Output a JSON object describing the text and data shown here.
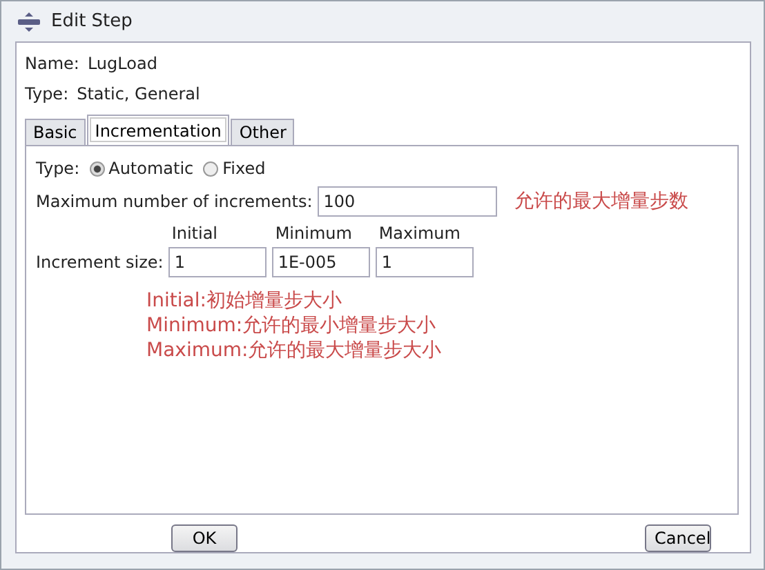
{
  "window": {
    "title": "Edit Step"
  },
  "name": {
    "label": "Name:",
    "value": "LugLoad"
  },
  "type": {
    "label": "Type:",
    "value": "Static, General"
  },
  "tabs": [
    {
      "label": "Basic",
      "selected": false
    },
    {
      "label": "Incrementation",
      "selected": true
    },
    {
      "label": "Other",
      "selected": false
    }
  ],
  "incrementation_type": {
    "label": "Type:",
    "options": [
      {
        "label": "Automatic",
        "selected": true
      },
      {
        "label": "Fixed",
        "selected": false
      }
    ]
  },
  "max_increments": {
    "label": "Maximum number of increments:",
    "value": "100",
    "note": "允许的最大增量步数"
  },
  "increment_size": {
    "label": "Increment size:",
    "fields": [
      {
        "heading": "Initial",
        "value": "1"
      },
      {
        "heading": "Minimum",
        "value": "1E-005"
      },
      {
        "heading": "Maximum",
        "value": "1"
      }
    ]
  },
  "notes": [
    "Initial:初始增量步大小",
    "Minimum:允许的最小增量步大小",
    "Maximum:允许的最大增量步大小"
  ],
  "buttons": [
    "OK",
    "Cancel"
  ]
}
